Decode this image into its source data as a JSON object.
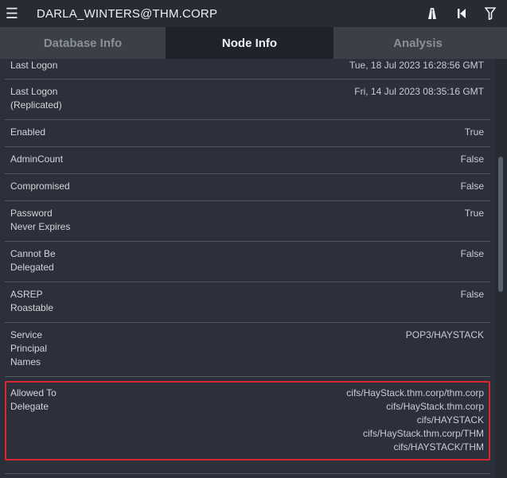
{
  "header": {
    "title": "DARLA_WINTERS@THM.CORP",
    "menu_icon": "hamburger-menu-icon",
    "actions": [
      "road-icon",
      "skip-back-icon",
      "filter-icon"
    ]
  },
  "tabs": [
    {
      "label": "Database Info",
      "active": false
    },
    {
      "label": "Node Info",
      "active": true
    },
    {
      "label": "Analysis",
      "active": false
    }
  ],
  "properties": [
    {
      "label": "Last Logon",
      "values": [
        "Tue, 18 Jul 2023 16:28:56 GMT"
      ]
    },
    {
      "label": "Last Logon\n(Replicated)",
      "values": [
        "Fri, 14 Jul 2023 08:35:16 GMT"
      ]
    },
    {
      "label": "Enabled",
      "values": [
        "True"
      ]
    },
    {
      "label": "AdminCount",
      "values": [
        "False"
      ]
    },
    {
      "label": "Compromised",
      "values": [
        "False"
      ]
    },
    {
      "label": "Password\nNever Expires",
      "values": [
        "True"
      ]
    },
    {
      "label": "Cannot Be\nDelegated",
      "values": [
        "False"
      ]
    },
    {
      "label": "ASREP\nRoastable",
      "values": [
        "False"
      ]
    },
    {
      "label": "Service\nPrincipal\nNames",
      "values": [
        "POP3/HAYSTACK"
      ]
    },
    {
      "label": "Allowed To\nDelegate",
      "values": [
        "cifs/HayStack.thm.corp/thm.corp",
        "cifs/HayStack.thm.corp",
        "cifs/HAYSTACK",
        "cifs/HayStack.thm.corp/THM",
        "cifs/HAYSTACK/THM"
      ]
    }
  ],
  "colors": {
    "highlight": "#d8272e",
    "active_tab": "#1f232b"
  }
}
